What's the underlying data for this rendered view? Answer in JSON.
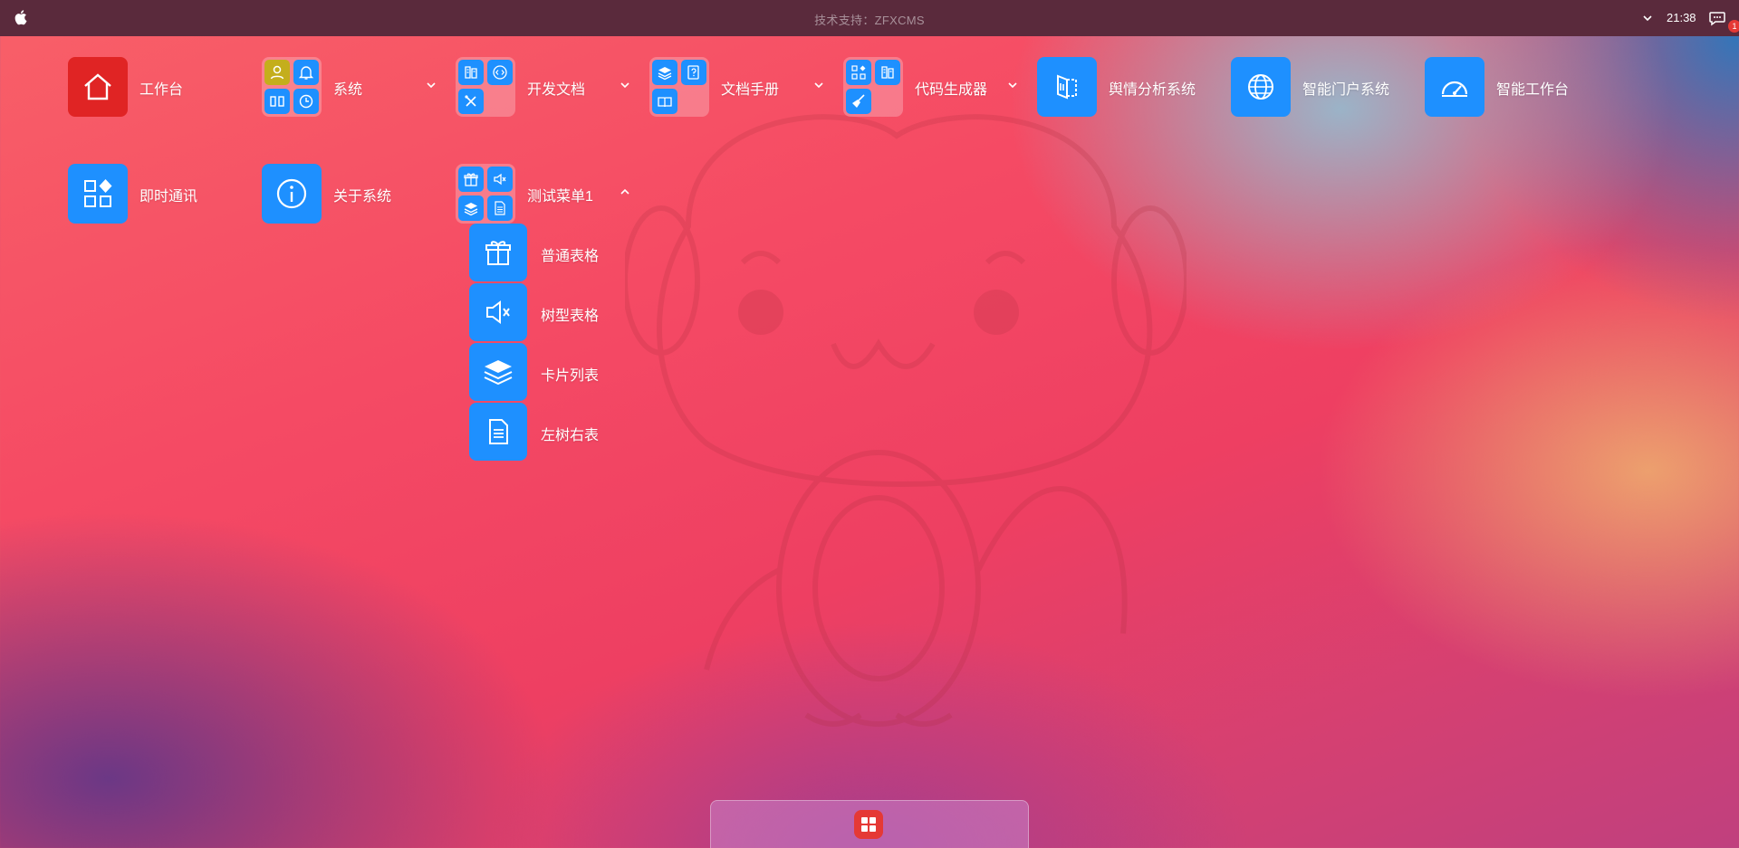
{
  "topbar": {
    "title": "技术支持：ZFXCMS",
    "time": "21:38",
    "badge": "1"
  },
  "desktop": {
    "row1": [
      {
        "label": "工作台",
        "icon": "home-icon",
        "color": "#e02424"
      },
      {
        "label": "系统",
        "icons": [
          "user-icon",
          "bell-icon",
          "columns-icon",
          "clock-icon"
        ]
      },
      {
        "label": "开发文档",
        "icons": [
          "panel-icon",
          "code-icon",
          "tools-icon"
        ]
      },
      {
        "label": "文档手册",
        "icons": [
          "layers-icon",
          "help-doc-icon",
          "book-icon"
        ]
      },
      {
        "label": "代码生成器",
        "icons": [
          "apps-icon",
          "panel-icon",
          "broom-icon"
        ]
      },
      {
        "label": "舆情分析系统",
        "icon": "panel-icon"
      },
      {
        "label": "智能门户系统",
        "icon": "globe-icon"
      },
      {
        "label": "智能工作台",
        "icon": "gauge-icon"
      }
    ],
    "row2": [
      {
        "label": "即时通讯",
        "icon": "apps-icon"
      },
      {
        "label": "关于系统",
        "icon": "info-icon"
      },
      {
        "label": "测试菜单1",
        "icons": [
          "gift-icon",
          "mute-icon",
          "layers-icon",
          "document-icon"
        ]
      }
    ],
    "submenu": [
      {
        "label": "普通表格",
        "icon": "gift-icon"
      },
      {
        "label": "树型表格",
        "icon": "mute-icon"
      },
      {
        "label": "卡片列表",
        "icon": "layers-icon"
      },
      {
        "label": "左树右表",
        "icon": "document-icon"
      }
    ]
  },
  "dock": {
    "icon": "grid-icon"
  },
  "colors": {
    "tile_blue": "#1e90ff",
    "tile_red": "#e02424",
    "tile_olive": "#c4ae1c",
    "topbar": "#5a2a3c"
  }
}
